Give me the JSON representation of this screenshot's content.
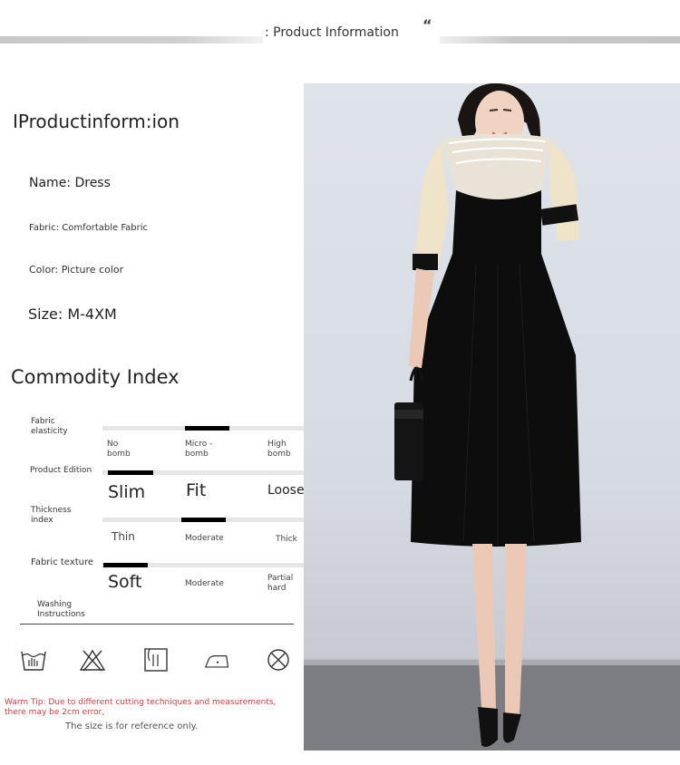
{
  "header": {
    "title": ": Product Information",
    "quote_mark": "“"
  },
  "info": {
    "section_title": "IProductinform:ion",
    "name": "Name: Dress",
    "fabric": "Fabric: Comfortable Fabric",
    "color": "Color: Picture color",
    "size": "Size: M-4XM"
  },
  "index": {
    "section_title": "Commodity Index",
    "rows": [
      {
        "label": "Fabric elasticity",
        "options": [
          "No bomb",
          "Micro -bomb",
          "High bomb"
        ],
        "selected": 1
      },
      {
        "label": "Product Edition",
        "options": [
          "Slim",
          "Fit",
          "Loose"
        ],
        "selected": 0
      },
      {
        "label": "Thickness index",
        "options": [
          "Thin",
          "Moderate",
          "Thick"
        ],
        "selected": 1
      },
      {
        "label": "Fabric texture",
        "options": [
          "Soft",
          "Moderate",
          "Partial hard"
        ],
        "selected": 0
      }
    ],
    "washing_label": "Washing Instructions"
  },
  "wash_icons": [
    "hand-wash-icon",
    "no-bleach-icon",
    "tumble-dry-icon",
    "low-iron-icon",
    "no-dry-clean-icon"
  ],
  "warm_tip": "Warm Tip: Due to different cutting techniques and measurements, there may be 2cm error,",
  "reference_note": "The size is for reference only.",
  "colors": {
    "accent_red": "#d04040",
    "index_mark": "#000000",
    "dress": "#0d0d0d",
    "sleeve": "#f0e6cf"
  }
}
